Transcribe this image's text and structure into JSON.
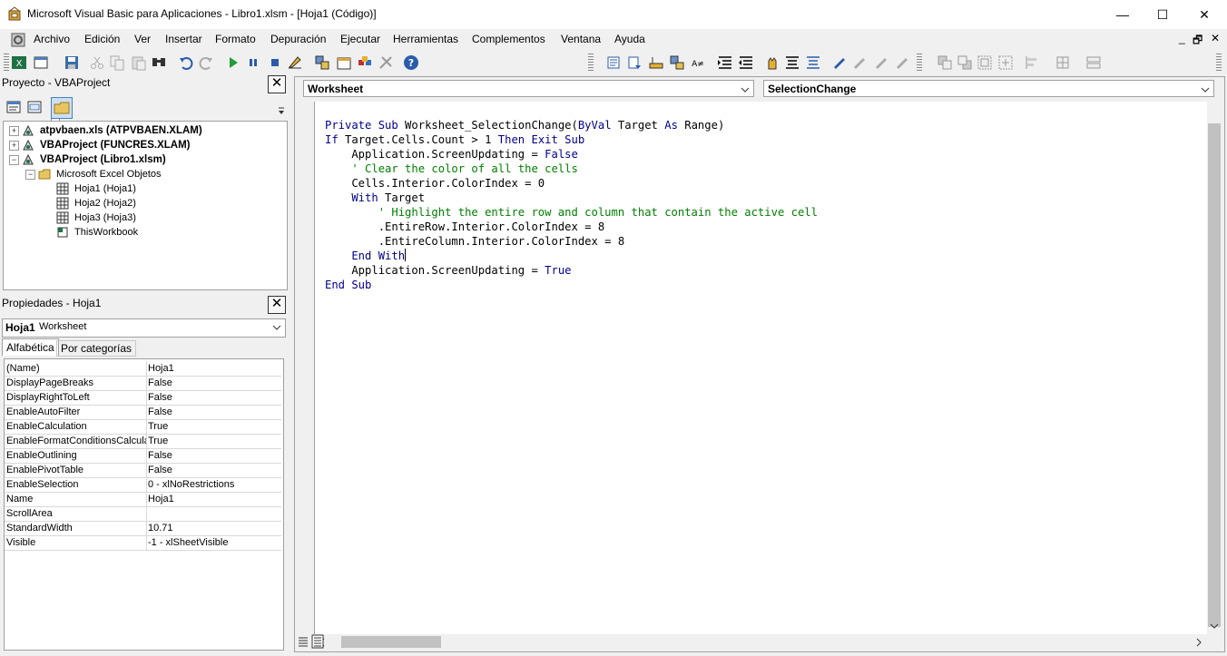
{
  "window": {
    "title": "Microsoft Visual Basic para Aplicaciones - Libro1.xlsm - [Hoja1 (Código)]",
    "minimize_glyph": "—",
    "maximize_glyph": "☐",
    "close_glyph": "✕"
  },
  "menubar": {
    "items": [
      "Archivo",
      "Edición",
      "Ver",
      "Insertar",
      "Formato",
      "Depuración",
      "Ejecutar",
      "Herramientas",
      "Complementos",
      "Ventana",
      "Ayuda"
    ],
    "mdi_minimize": "_",
    "mdi_restore": "🗗",
    "mdi_close": "✕"
  },
  "toolbar": {
    "icons": [
      "excel-view-icon",
      "insert-module-icon",
      "dropdown-icon",
      "save-icon",
      "cut-icon",
      "copy-icon",
      "paste-icon",
      "find-icon",
      "undo-icon",
      "redo-icon",
      "run-icon",
      "break-icon",
      "reset-icon",
      "design-mode-icon",
      "project-explorer-icon",
      "properties-icon",
      "object-browser-icon",
      "toolbox-icon",
      "help-icon"
    ]
  },
  "project_pane": {
    "title": "Proyecto - VBAProject",
    "tree": [
      {
        "label": "atpvbaen.xls (ATPVBAEN.XLAM)",
        "bold": true,
        "level": 0,
        "expander": "+"
      },
      {
        "label": "VBAProject (FUNCRES.XLAM)",
        "bold": true,
        "level": 0,
        "expander": "+"
      },
      {
        "label": "VBAProject (Libro1.xlsm)",
        "bold": true,
        "level": 0,
        "expander": "−"
      },
      {
        "label": "Microsoft Excel Objetos",
        "bold": false,
        "level": 1,
        "expander": "−"
      },
      {
        "label": "Hoja1 (Hoja1)",
        "bold": false,
        "level": 2,
        "expander": ""
      },
      {
        "label": "Hoja2 (Hoja2)",
        "bold": false,
        "level": 2,
        "expander": ""
      },
      {
        "label": "Hoja3 (Hoja3)",
        "bold": false,
        "level": 2,
        "expander": ""
      },
      {
        "label": "ThisWorkbook",
        "bold": false,
        "level": 2,
        "expander": ""
      }
    ]
  },
  "properties_pane": {
    "title": "Propiedades - Hoja1",
    "object_name": "Hoja1",
    "object_type": "Worksheet",
    "tabs": [
      "Alfabética",
      "Por categorías"
    ],
    "rows": [
      {
        "name": "(Name)",
        "value": "Hoja1"
      },
      {
        "name": "DisplayPageBreaks",
        "value": "False"
      },
      {
        "name": "DisplayRightToLeft",
        "value": "False"
      },
      {
        "name": "EnableAutoFilter",
        "value": "False"
      },
      {
        "name": "EnableCalculation",
        "value": "True"
      },
      {
        "name": "EnableFormatConditionsCalculat",
        "value": "True"
      },
      {
        "name": "EnableOutlining",
        "value": "False"
      },
      {
        "name": "EnablePivotTable",
        "value": "False"
      },
      {
        "name": "EnableSelection",
        "value": "0 - xlNoRestrictions"
      },
      {
        "name": "Name",
        "value": "Hoja1"
      },
      {
        "name": "ScrollArea",
        "value": ""
      },
      {
        "name": "StandardWidth",
        "value": "10.71"
      },
      {
        "name": "Visible",
        "value": "-1 - xlSheetVisible"
      }
    ]
  },
  "code_window": {
    "object_combo": "Worksheet",
    "procedure_combo": "SelectionChange",
    "lines": [
      [
        {
          "t": "kw",
          "s": "Private Sub"
        },
        {
          "t": "cd",
          "s": " Worksheet_SelectionChange("
        },
        {
          "t": "kw",
          "s": "ByVal"
        },
        {
          "t": "cd",
          "s": " Target "
        },
        {
          "t": "kw",
          "s": "As"
        },
        {
          "t": "cd",
          "s": " Range)"
        }
      ],
      [
        {
          "t": "kw",
          "s": "If"
        },
        {
          "t": "cd",
          "s": " Target.Cells.Count > 1 "
        },
        {
          "t": "kw",
          "s": "Then Exit Sub"
        }
      ],
      [
        {
          "t": "cd",
          "s": "    Application.ScreenUpdating = "
        },
        {
          "t": "kw",
          "s": "False"
        }
      ],
      [
        {
          "t": "cm",
          "s": "    ' Clear the color of all the cells"
        }
      ],
      [
        {
          "t": "cd",
          "s": "    Cells.Interior.ColorIndex = 0"
        }
      ],
      [
        {
          "t": "kw",
          "s": "    With"
        },
        {
          "t": "cd",
          "s": " Target"
        }
      ],
      [
        {
          "t": "cm",
          "s": "        ' Highlight the entire row and column that contain the active cell"
        }
      ],
      [
        {
          "t": "cd",
          "s": "        .EntireRow.Interior.ColorIndex = 8"
        }
      ],
      [
        {
          "t": "cd",
          "s": "        .EntireColumn.Interior.ColorIndex = 8"
        }
      ],
      [
        {
          "t": "kw",
          "s": "    End With"
        },
        {
          "t": "caret",
          "s": ""
        }
      ],
      [
        {
          "t": "cd",
          "s": "    Application.ScreenUpdating = "
        },
        {
          "t": "kw",
          "s": "True"
        }
      ],
      [
        {
          "t": "kw",
          "s": "End Sub"
        }
      ]
    ]
  },
  "colors": {
    "keyword": "#00008b",
    "comment": "#008000",
    "code": "#000000"
  }
}
